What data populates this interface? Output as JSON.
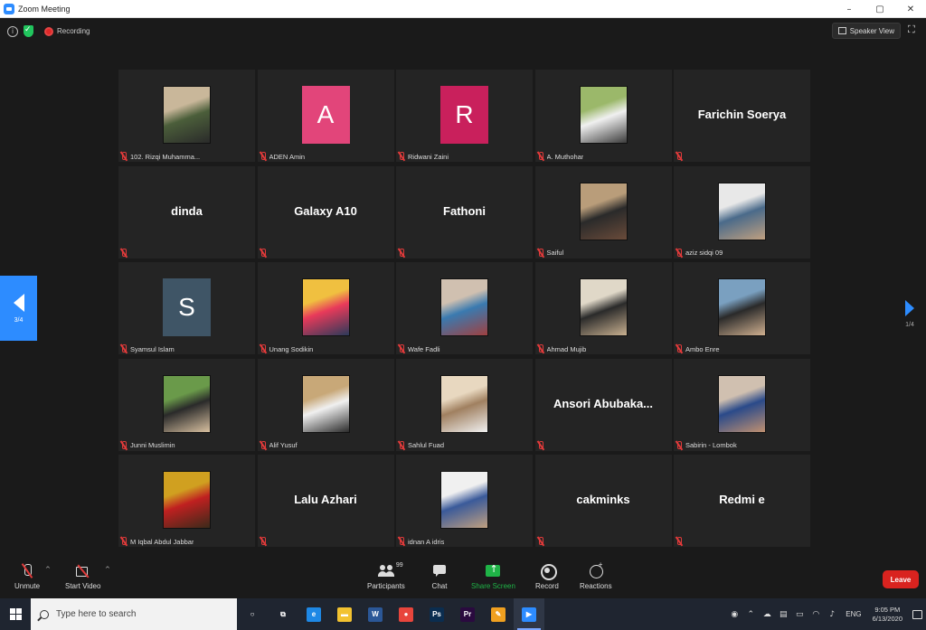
{
  "window": {
    "title": "Zoom Meeting",
    "controls": {
      "minimize": "–",
      "maximize": "▢",
      "close": "✕"
    }
  },
  "topbar": {
    "recording_label": "Recording",
    "view_label": "Speaker View",
    "fullscreen_glyph": "⛶"
  },
  "pager": {
    "left_page": "3/4",
    "right_page": "1/4"
  },
  "participants": [
    {
      "name": "102. Rizqi Muhamma...",
      "avatar": "photo",
      "photo_colors": [
        "#c9b79a",
        "#4b5e3a",
        "#2a2a2a"
      ]
    },
    {
      "name": "ADEN Amin",
      "avatar": "letter",
      "letter": "A",
      "letter_color": "#e2457a"
    },
    {
      "name": "Ridwani Zaini",
      "avatar": "letter",
      "letter": "R",
      "letter_color": "#c9205c"
    },
    {
      "name": "A. Muthohar",
      "avatar": "photo",
      "photo_colors": [
        "#9bb86a",
        "#f0f0f0",
        "#3b3b3b"
      ]
    },
    {
      "name": "",
      "big_name": "Farichin Soerya",
      "avatar": "text"
    },
    {
      "name": "",
      "big_name": "dinda",
      "avatar": "text"
    },
    {
      "name": "",
      "big_name": "Galaxy A10",
      "avatar": "text"
    },
    {
      "name": "",
      "big_name": "Fathoni",
      "avatar": "text"
    },
    {
      "name": "Saiful",
      "avatar": "photo",
      "photo_colors": [
        "#b99d7a",
        "#2a2a2a",
        "#6a4b3a"
      ]
    },
    {
      "name": "aziz sidqi 09",
      "avatar": "photo",
      "photo_colors": [
        "#e8e8e8",
        "#4a6a8a",
        "#c0a080"
      ]
    },
    {
      "name": "Syamsul Islam",
      "avatar": "letter",
      "letter": "S",
      "letter_color": "#3f5566"
    },
    {
      "name": "Unang Sodikin",
      "avatar": "photo",
      "photo_colors": [
        "#f0c040",
        "#e83a5a",
        "#2a3a5a"
      ]
    },
    {
      "name": "Wafe Fadli",
      "avatar": "photo",
      "photo_colors": [
        "#d0c0b0",
        "#3a7ab0",
        "#a04040"
      ]
    },
    {
      "name": "Ahmad Mujib",
      "avatar": "photo",
      "photo_colors": [
        "#e0d8c8",
        "#2a2a2a",
        "#c8b090"
      ]
    },
    {
      "name": "Ambo Enre",
      "avatar": "photo",
      "photo_colors": [
        "#7aa0c0",
        "#2a2a2a",
        "#d0b090"
      ]
    },
    {
      "name": "Junni Muslimin",
      "avatar": "photo",
      "photo_colors": [
        "#6a9a4a",
        "#2a2a2a",
        "#d8c0a0"
      ]
    },
    {
      "name": "Alif Yusuf",
      "avatar": "photo",
      "photo_colors": [
        "#c8a878",
        "#f0f0f0",
        "#2a2a2a"
      ]
    },
    {
      "name": "Sahlul Fuad",
      "avatar": "photo",
      "photo_colors": [
        "#e8d8c0",
        "#a08060",
        "#f0f0f0"
      ]
    },
    {
      "name": "",
      "big_name": "Ansori Abubaka...",
      "avatar": "text"
    },
    {
      "name": "Sabirin - Lombok",
      "avatar": "photo",
      "photo_colors": [
        "#d0c0b0",
        "#2a4a8a",
        "#c09070"
      ]
    },
    {
      "name": "M Iqbal Abdul Jabbar",
      "avatar": "photo",
      "photo_colors": [
        "#d0a020",
        "#c02020",
        "#3a2a1a"
      ]
    },
    {
      "name": "",
      "big_name": "Lalu Azhari",
      "avatar": "text"
    },
    {
      "name": "idnan A idris",
      "avatar": "photo",
      "photo_colors": [
        "#f0f0f0",
        "#3a5a9a",
        "#c0a080"
      ]
    },
    {
      "name": "",
      "big_name": "cakminks",
      "avatar": "text"
    },
    {
      "name": "",
      "big_name": "Redmi e",
      "avatar": "text"
    }
  ],
  "toolbar": {
    "unmute": "Unmute",
    "start_video": "Start Video",
    "participants": "Participants",
    "participants_count": "99",
    "chat": "Chat",
    "share_screen": "Share Screen",
    "record": "Record",
    "reactions": "Reactions",
    "leave": "Leave",
    "caret": "^"
  },
  "taskbar": {
    "search_placeholder": "Type here to search",
    "apps": [
      {
        "name": "cortana-icon",
        "glyph": "○",
        "bg": "transparent"
      },
      {
        "name": "task-view-icon",
        "glyph": "⧉",
        "bg": "transparent"
      },
      {
        "name": "edge-icon",
        "glyph": "e",
        "bg": "#1e88e5"
      },
      {
        "name": "file-explorer-icon",
        "glyph": "▬",
        "bg": "#f2c230"
      },
      {
        "name": "word-icon",
        "glyph": "W",
        "bg": "#2b5797"
      },
      {
        "name": "chrome-icon",
        "glyph": "●",
        "bg": "#e8453c"
      },
      {
        "name": "photoshop-icon",
        "glyph": "Ps",
        "bg": "#0b2d4f"
      },
      {
        "name": "premiere-icon",
        "glyph": "Pr",
        "bg": "#2a0a3f"
      },
      {
        "name": "paint-icon",
        "glyph": "✎",
        "bg": "#f0a020"
      },
      {
        "name": "zoom-icon",
        "glyph": "▶",
        "bg": "#2d8cff"
      }
    ],
    "tray": {
      "lang": "ENG",
      "time": "9:05 PM",
      "date": "6/13/2020"
    }
  }
}
